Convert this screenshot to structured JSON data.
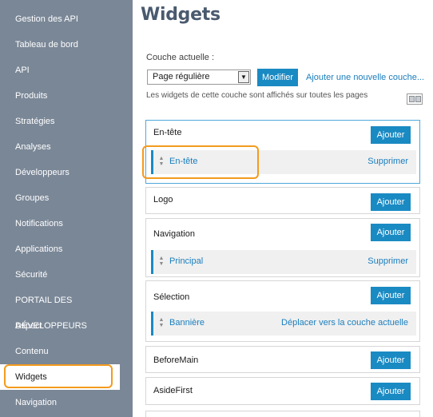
{
  "sidebar": {
    "items": [
      {
        "label": "Gestion des API"
      },
      {
        "label": "Tableau de bord"
      },
      {
        "label": "API"
      },
      {
        "label": "Produits"
      },
      {
        "label": "Stratégies"
      },
      {
        "label": "Analyses"
      },
      {
        "label": "Développeurs"
      },
      {
        "label": "Groupes"
      },
      {
        "label": "Notifications"
      },
      {
        "label": "Applications"
      },
      {
        "label": "Sécurité"
      },
      {
        "label": "PORTAIL DES DÉVELOPPEURS"
      },
      {
        "label": "Aspect"
      },
      {
        "label": "Contenu"
      },
      {
        "label": "Widgets",
        "active": true
      },
      {
        "label": "Navigation"
      }
    ]
  },
  "main": {
    "title": "Widgets",
    "layer": {
      "label": "Couche actuelle :",
      "selected": "Page régulière",
      "modify_label": "Modifier",
      "add_layer_link": "Ajouter une nouvelle couche...",
      "note": "Les widgets de cette couche sont affichés sur toutes les pages"
    },
    "add_label": "Ajouter",
    "zones": [
      {
        "title": "En-tête",
        "selected": true,
        "widgets": [
          {
            "name": "En-tête",
            "action": "Supprimer"
          }
        ]
      },
      {
        "title": "Logo",
        "widgets": []
      },
      {
        "title": "Navigation",
        "widgets": [
          {
            "name": "Principal",
            "action": "Supprimer"
          }
        ]
      },
      {
        "title": "Sélection",
        "widgets": [
          {
            "name": "Bannière",
            "action": "Déplacer vers la couche actuelle"
          }
        ]
      },
      {
        "title": "BeforeMain",
        "widgets": []
      },
      {
        "title": "AsideFirst",
        "widgets": []
      }
    ]
  },
  "colors": {
    "sidebar_bg": "#7a8797",
    "accent": "#1a8ac3",
    "link": "#1a7ebd",
    "highlight": "#f39b1e"
  },
  "icons": {
    "dropdown": "chevron-down-icon",
    "drag": "drag-handle-icon",
    "view_toggle": "layout-toggle-icon"
  }
}
